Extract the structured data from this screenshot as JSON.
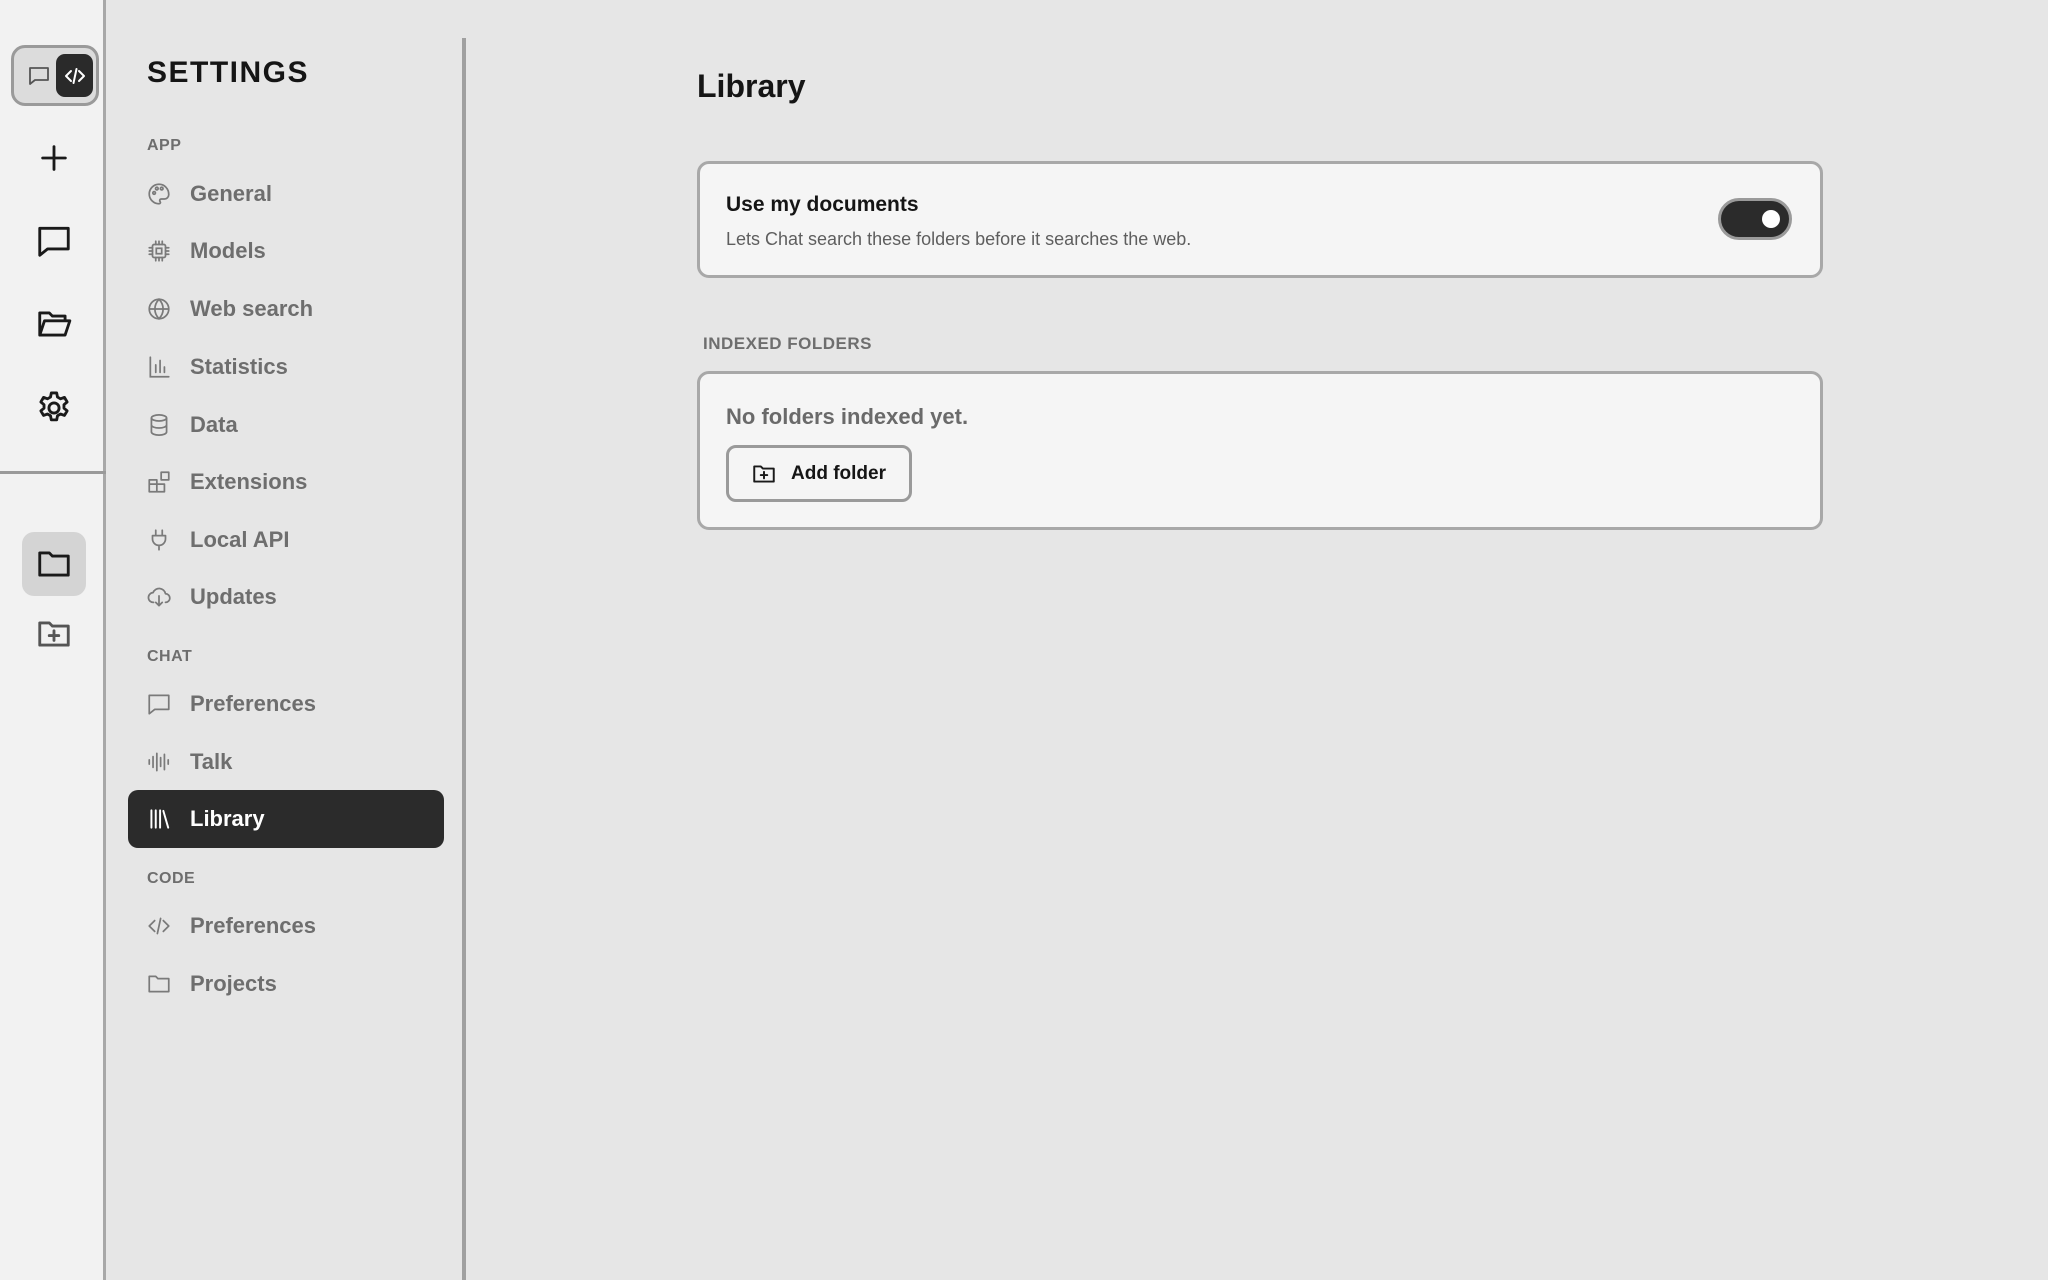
{
  "rail": {
    "mode_options": [
      "chat",
      "code"
    ],
    "active_mode": "code",
    "buttons": [
      {
        "name": "new",
        "icon": "plus-icon"
      },
      {
        "name": "chats",
        "icon": "chat-bubble-icon"
      },
      {
        "name": "open-folder",
        "icon": "folder-open-icon"
      },
      {
        "name": "settings",
        "icon": "gear-icon"
      },
      {
        "name": "projects",
        "icon": "folder-icon",
        "active": true
      },
      {
        "name": "add-project",
        "icon": "folder-plus-icon"
      }
    ]
  },
  "sidebar": {
    "title": "SETTINGS",
    "groups": [
      {
        "label": "APP",
        "items": [
          {
            "label": "General",
            "icon": "palette-icon"
          },
          {
            "label": "Models",
            "icon": "chip-icon"
          },
          {
            "label": "Web search",
            "icon": "globe-icon"
          },
          {
            "label": "Statistics",
            "icon": "bar-chart-icon"
          },
          {
            "label": "Data",
            "icon": "database-icon"
          },
          {
            "label": "Extensions",
            "icon": "blocks-icon"
          },
          {
            "label": "Local API",
            "icon": "plug-icon"
          },
          {
            "label": "Updates",
            "icon": "cloud-download-icon"
          }
        ]
      },
      {
        "label": "CHAT",
        "items": [
          {
            "label": "Preferences",
            "icon": "chat-bubble-icon"
          },
          {
            "label": "Talk",
            "icon": "audio-wave-icon"
          },
          {
            "label": "Library",
            "icon": "library-icon",
            "active": true
          }
        ]
      },
      {
        "label": "CODE",
        "items": [
          {
            "label": "Preferences",
            "icon": "code-icon"
          },
          {
            "label": "Projects",
            "icon": "folder-icon"
          }
        ]
      }
    ]
  },
  "main": {
    "title": "Library",
    "use_documents": {
      "title": "Use my documents",
      "description": "Lets Chat search these folders before it searches the web.",
      "enabled": true
    },
    "indexed_folders": {
      "label": "INDEXED FOLDERS",
      "empty_text": "No folders indexed yet.",
      "add_button_label": "Add folder"
    }
  },
  "colors": {
    "background": "#e6e6e6",
    "rail_background": "#f2f2f2",
    "card_background": "#f5f5f5",
    "active_fill": "#2b2b2b",
    "muted_text": "#6e6e6e",
    "border": "#a8a8a8"
  }
}
